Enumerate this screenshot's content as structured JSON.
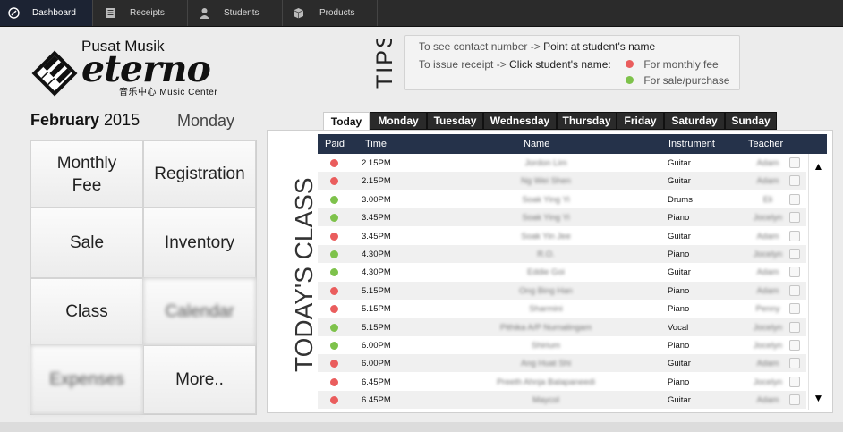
{
  "nav": [
    {
      "label": "Dashboard",
      "icon": "dashboard-icon",
      "active": true
    },
    {
      "label": "Receipts",
      "icon": "receipt-icon"
    },
    {
      "label": "Students",
      "icon": "student-icon"
    },
    {
      "label": "Products",
      "icon": "box-icon"
    }
  ],
  "logo": {
    "top": "Pusat Musik",
    "word": "eterno",
    "sub": "音乐中心 Music Center"
  },
  "tips": {
    "title": "TIPS",
    "row1": {
      "k": "To see contact number -> ",
      "v": "Point at student's name"
    },
    "row2": {
      "k": "To issue receipt -> ",
      "v": "Click student's name:"
    },
    "legend1": "For monthly fee",
    "legend2": "For sale/purchase",
    "colors": {
      "monthly": "#ea5d5d",
      "sale": "#7ec24b"
    }
  },
  "date": {
    "month": "February",
    "year": "2015",
    "weekday": "Monday"
  },
  "menu": [
    {
      "label": "Monthly Fee",
      "blur": false
    },
    {
      "label": "Registration",
      "blur": false
    },
    {
      "label": "Sale",
      "blur": false
    },
    {
      "label": "Inventory",
      "blur": false
    },
    {
      "label": "Class",
      "blur": false
    },
    {
      "label": "Calendar",
      "blur": true
    },
    {
      "label": "Expenses",
      "blur": true
    },
    {
      "label": "More..",
      "blur": false
    }
  ],
  "tabs": [
    "Today",
    "Monday",
    "Tuesday",
    "Wednesday",
    "Thursday",
    "Friday",
    "Saturday",
    "Sunday"
  ],
  "active_tab": "Today",
  "class_title": "TODAY'S CLASS",
  "columns": {
    "paid": "Paid",
    "time": "Time",
    "name": "Name",
    "instrument": "Instrument",
    "teacher": "Teacher"
  },
  "rows": [
    {
      "paid": "red",
      "time": "2.15PM",
      "name": "Jordon Lim",
      "instrument": "Guitar",
      "teacher": "Adam"
    },
    {
      "paid": "red",
      "time": "2.15PM",
      "name": "Ng Wei Shen",
      "instrument": "Guitar",
      "teacher": "Adam"
    },
    {
      "paid": "green",
      "time": "3.00PM",
      "name": "Soak Ying Yi",
      "instrument": "Drums",
      "teacher": "Eli"
    },
    {
      "paid": "green",
      "time": "3.45PM",
      "name": "Soak Ying Yi",
      "instrument": "Piano",
      "teacher": "Jocelyn"
    },
    {
      "paid": "red",
      "time": "3.45PM",
      "name": "Soak Yin Jee",
      "instrument": "Guitar",
      "teacher": "Adam"
    },
    {
      "paid": "green",
      "time": "4.30PM",
      "name": "R.O.",
      "instrument": "Piano",
      "teacher": "Jocelyn"
    },
    {
      "paid": "green",
      "time": "4.30PM",
      "name": "Eddie Goi",
      "instrument": "Guitar",
      "teacher": "Adam"
    },
    {
      "paid": "red",
      "time": "5.15PM",
      "name": "Ong Bing Han",
      "instrument": "Piano",
      "teacher": "Adam"
    },
    {
      "paid": "red",
      "time": "5.15PM",
      "name": "Sharmini",
      "instrument": "Piano",
      "teacher": "Penny"
    },
    {
      "paid": "green",
      "time": "5.15PM",
      "name": "Pithika A/P Nurnalingam",
      "instrument": "Vocal",
      "teacher": "Jocelyn"
    },
    {
      "paid": "green",
      "time": "6.00PM",
      "name": "Shirium",
      "instrument": "Piano",
      "teacher": "Jocelyn"
    },
    {
      "paid": "red",
      "time": "6.00PM",
      "name": "Ang Huat Shi",
      "instrument": "Guitar",
      "teacher": "Adam"
    },
    {
      "paid": "red",
      "time": "6.45PM",
      "name": "Preeth Ahnja Balapaneedi",
      "instrument": "Piano",
      "teacher": "Jocelyn"
    },
    {
      "paid": "red",
      "time": "6.45PM",
      "name": "Maycol",
      "instrument": "Guitar",
      "teacher": "Adam"
    }
  ],
  "scroll": {
    "up": "▲",
    "down": "▼"
  }
}
